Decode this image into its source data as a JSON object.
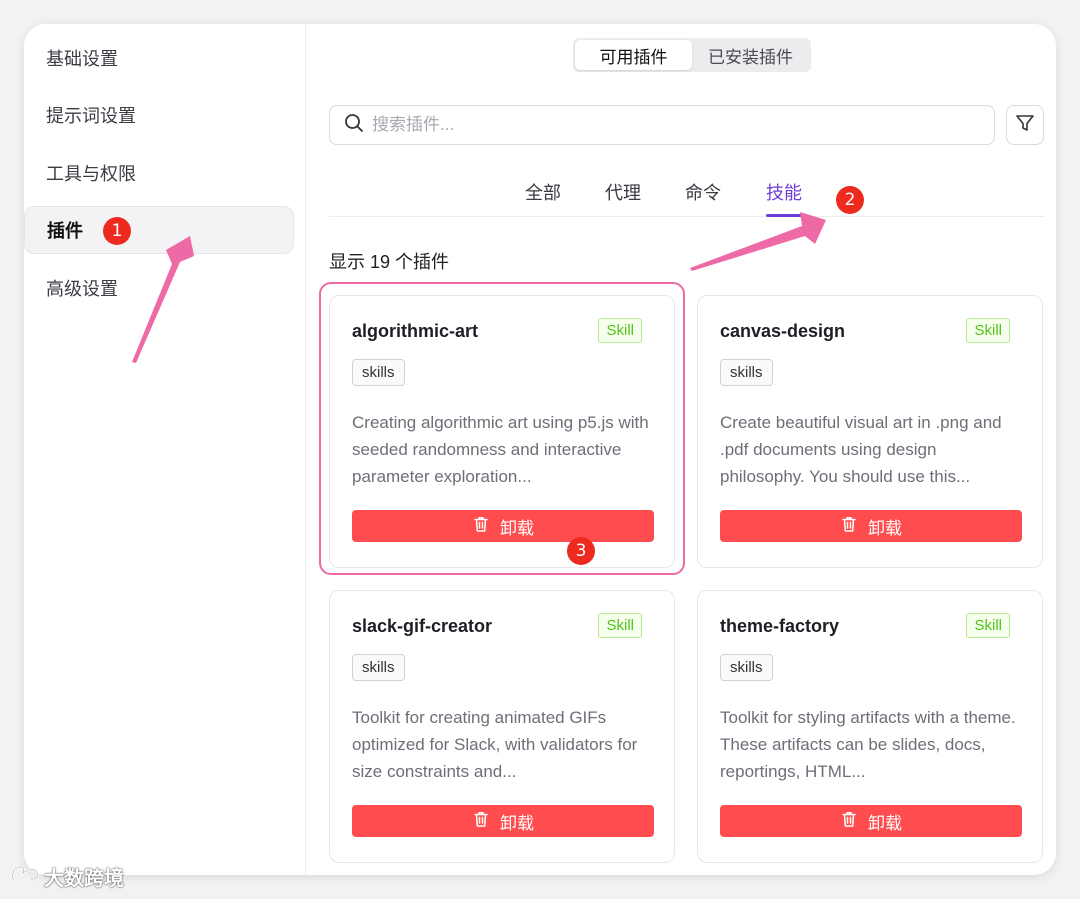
{
  "colors": {
    "accent": "#6b3fd6",
    "danger": "#ff4d4f",
    "skill_badge": "#52c41a",
    "annotation": "#ee6aa7",
    "marker": "#ee2a1f"
  },
  "sidebar": {
    "items": [
      {
        "label": "基础设置"
      },
      {
        "label": "提示词设置"
      },
      {
        "label": "工具与权限"
      },
      {
        "label": "插件",
        "active": true
      },
      {
        "label": "高级设置"
      }
    ]
  },
  "segmented": {
    "available": "可用插件",
    "installed": "已安装插件"
  },
  "search": {
    "placeholder": "搜索插件..."
  },
  "icons": {
    "search": "search-icon",
    "filter": "filter-icon",
    "trash": "trash-icon"
  },
  "tabs": [
    {
      "label": "全部"
    },
    {
      "label": "代理"
    },
    {
      "label": "命令"
    },
    {
      "label": "技能",
      "active": true
    }
  ],
  "count_text": "显示 19 个插件",
  "cards": [
    {
      "title": "algorithmic-art",
      "badge": "Skill",
      "tag": "skills",
      "description": "Creating algorithmic art using p5.js with seeded randomness and interactive parameter exploration...",
      "button": "卸载"
    },
    {
      "title": "canvas-design",
      "badge": "Skill",
      "tag": "skills",
      "description": "Create beautiful visual art in .png and .pdf documents using design philosophy. You should use this...",
      "button": "卸载"
    },
    {
      "title": "slack-gif-creator",
      "badge": "Skill",
      "tag": "skills",
      "description": "Toolkit for creating animated GIFs optimized for Slack, with validators for size constraints and...",
      "button": "卸载"
    },
    {
      "title": "theme-factory",
      "badge": "Skill",
      "tag": "skills",
      "description": "Toolkit for styling artifacts with a theme. These artifacts can be slides, docs, reportings, HTML...",
      "button": "卸载"
    }
  ],
  "annotations": {
    "markers": [
      "1",
      "2",
      "3"
    ]
  },
  "watermark": "大数跨境"
}
